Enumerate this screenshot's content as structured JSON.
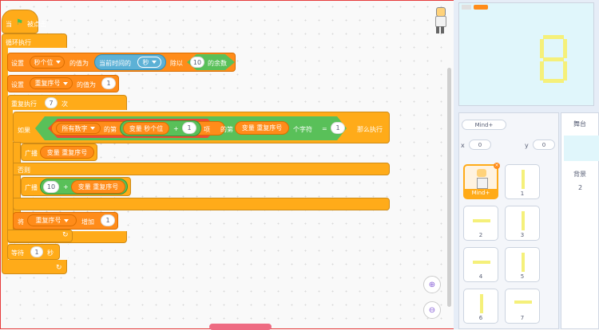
{
  "colors": {
    "control": "#ffab19",
    "data": "#ff8c1a",
    "operator": "#59c059",
    "sensing": "#5cb1d6",
    "stage_bg": "#e0f6fb",
    "segment": "#f5f07a",
    "frame": "#e63b3b"
  },
  "script": {
    "hat": {
      "when": "当",
      "flag_icon": "green-flag",
      "clicked": "被点击"
    },
    "forever": "循环执行",
    "set1": {
      "set": "设置",
      "var": "秒个位",
      "value_of": "的值为",
      "sensing_label": "当前时间的",
      "sensing_opt": "秒",
      "mod": "除以",
      "divisor": "10",
      "remainder": "的余数"
    },
    "set2": {
      "set": "设置",
      "var": "重复序号",
      "value_of": "的值为",
      "value": "1"
    },
    "repeat": {
      "label": "重复执行",
      "count": "7",
      "times": "次"
    },
    "if": {
      "if": "如果",
      "list": "所有数字",
      "of_item": "的第",
      "var_label": "变量",
      "var1": "秒个位",
      "plus": "+",
      "one": "1",
      "item": "项",
      "of_char": "的第",
      "var_label2": "变量",
      "var2": "重复序号",
      "char": "个字符",
      "equals": "=",
      "eq_val": "1",
      "then": "那么执行"
    },
    "broadcast1": {
      "label": "广播",
      "var_label": "变量",
      "var": "重复序号"
    },
    "else": "否则",
    "broadcast2": {
      "label": "广播",
      "num": "10",
      "plus": "+",
      "var_label": "变量",
      "var": "重复序号"
    },
    "change": {
      "label": "将",
      "var": "重复序号",
      "increase": "增加",
      "value": "1"
    },
    "wait": {
      "label": "等待",
      "value": "1",
      "unit": "秒"
    }
  },
  "zoom": {
    "in_icon": "zoom-in-icon",
    "out_icon": "zoom-out-icon"
  },
  "stage": {
    "badge": "",
    "digit": "8"
  },
  "sprite_info": {
    "name": "Mind+",
    "x_label": "x",
    "x": "0",
    "y_label": "y",
    "y": "0"
  },
  "sprites": [
    {
      "label": "Mind+",
      "selected": true
    },
    {
      "label": "1"
    },
    {
      "label": "2"
    },
    {
      "label": "3"
    },
    {
      "label": "4"
    },
    {
      "label": "5"
    },
    {
      "label": "6"
    },
    {
      "label": "7"
    }
  ],
  "stage_panel": {
    "title": "舞台",
    "backdrops_label": "背景",
    "backdrops_count": "2"
  }
}
